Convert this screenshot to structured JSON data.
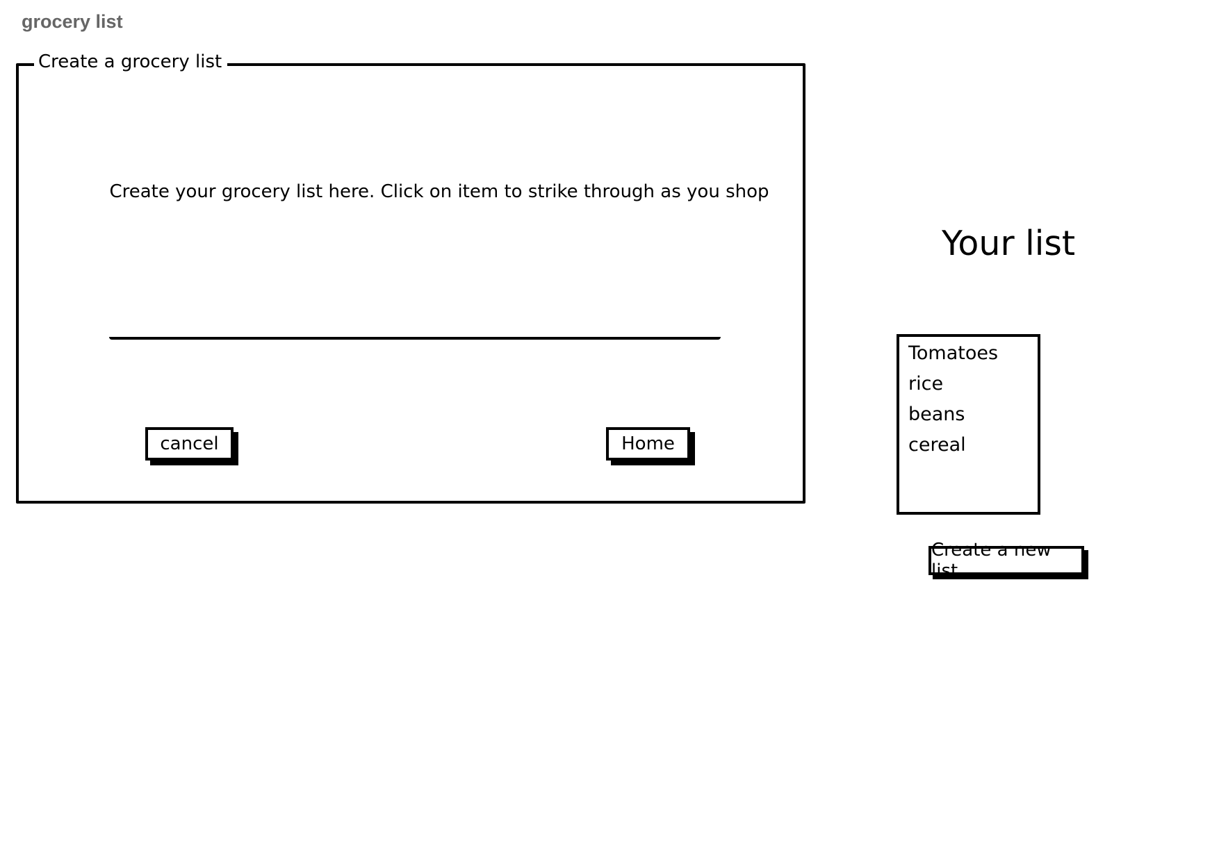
{
  "app": {
    "title": "grocery list"
  },
  "create_panel": {
    "legend": "Create a grocery list",
    "instructions": "Create your grocery list here. Click on item to strike through as you shop",
    "input_value": "",
    "cancel_label": "cancel",
    "home_label": "Home"
  },
  "your_list": {
    "title": "Your list",
    "items": [
      "Tomatoes",
      "rice",
      "beans",
      "cereal"
    ],
    "new_list_label": "Create a new list"
  }
}
